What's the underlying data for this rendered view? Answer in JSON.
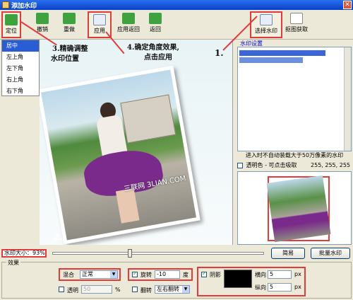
{
  "window": {
    "title": "添加水印",
    "close_label": "✕"
  },
  "toolbar": {
    "locate": "定位",
    "undo": "撤销",
    "redo": "重做",
    "apply": "应用",
    "apply_back": "应用返回",
    "back": "返回",
    "select_watermark": "选择水印",
    "capture": "抠图获取"
  },
  "position_menu": {
    "items": [
      "居中",
      "左上角",
      "左下角",
      "右上角",
      "右下角"
    ],
    "selected": "居中"
  },
  "annotations": {
    "step3": "3.精确调整",
    "step3b": "水印位置",
    "step4": "4.确定角度效果,",
    "step4b": "点击应用",
    "step1": "1.",
    "step2": "2."
  },
  "canvas": {
    "watermark_text": "三联网 3LIAN.COM"
  },
  "right_panel": {
    "group_title": "水印设置",
    "hint": "进入时不自动装载大于50万像素的水印",
    "transparent_label": "透明色 - 可点击吸取",
    "rgb": "255, 255, 255"
  },
  "size_bar": {
    "label": "水印大小：",
    "value": "93%",
    "slider_position": 0.36,
    "simple_btn": "简易",
    "batch_btn": "批量水印"
  },
  "effects": {
    "legend": "效果",
    "blend_label": "混合",
    "blend_value": "正常",
    "transparency_label": "透明",
    "transparency_value": "50",
    "percent": "%",
    "rotate_label": "旋转",
    "rotate_value": "-10",
    "degree": "度",
    "flip_label": "翻转",
    "flip_value": "左右翻转",
    "shadow_label": "阴影",
    "h_label": "横向",
    "h_value": "5",
    "v_label": "纵向",
    "v_value": "5",
    "px": "px",
    "shadow_color": "#000000"
  }
}
